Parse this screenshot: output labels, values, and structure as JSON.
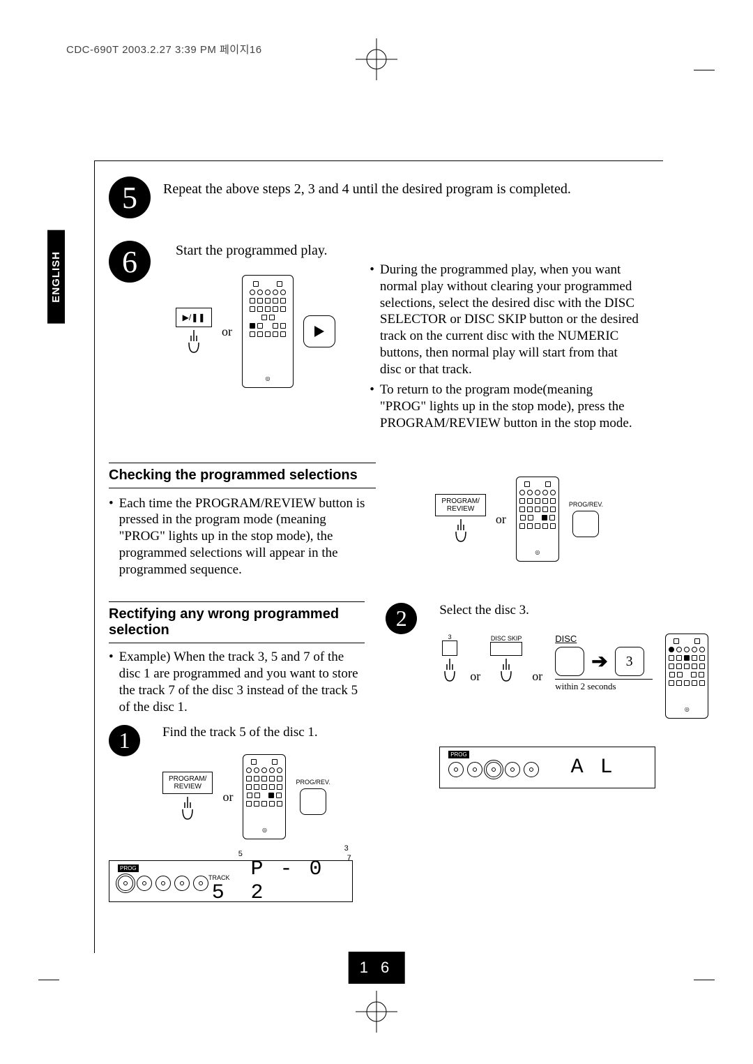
{
  "header": "CDC-690T  2003.2.27 3:39 PM  페이지16",
  "langTab": "ENGLISH",
  "pageNumber": "1 6",
  "step5": {
    "number": "5",
    "text": "Repeat the above steps 2, 3 and 4 until the desired program is completed."
  },
  "step6": {
    "number": "6",
    "text": "Start the programmed play.",
    "or": "or",
    "bullets": [
      "During the programmed play, when you want normal play without clearing your programmed selections, select the desired disc with the DISC SELECTOR or DISC SKIP button or the desired track on the current disc with the NUMERIC buttons, then normal play will start from that disc or that track.",
      "To return to the program mode(meaning \"PROG\" lights up in the stop mode), press the PROGRAM/REVIEW button in the stop mode."
    ],
    "playPauseLabel": "▶/❚❚"
  },
  "checking": {
    "heading": "Checking the programmed selections",
    "bullet": "Each time the PROGRAM/REVIEW button is pressed in the program mode (meaning \"PROG\" lights up in the stop mode), the programmed selections will appear in the programmed sequence.",
    "buttonLabel": "PROGRAM/\nREVIEW",
    "remoteBtnLabel": "PROG/REV.",
    "or": "or"
  },
  "rectifying": {
    "heading": "Rectifying any wrong programmed selection",
    "exampleLabel": "Example)",
    "exampleBody": "When the track 3, 5 and 7 of the disc 1 are programmed and you want to store the track 7 of the disc 3 instead of the track 5 of the disc 1.",
    "step1": {
      "num": "1",
      "text": "Find the track 5 of the disc 1.",
      "buttonLabel": "PROGRAM/\nREVIEW",
      "remoteBtnLabel": "PROG/REV.",
      "or": "or",
      "lcd": {
        "prog": "PROG",
        "trackLabel": "TRACK",
        "trackValue": "5",
        "super1": "5",
        "super2": "3",
        "super3": "7",
        "right": "P - 0 2"
      }
    },
    "step2": {
      "num": "2",
      "text": "Select the disc 3.",
      "or": "or",
      "numBtnLabel": "3",
      "numBtnTop": "3",
      "diskSkipLabel": "DISC SKIP",
      "discLabel": "DISC",
      "withinLabel": "within 2 seconds",
      "lcd": {
        "prog": "PROG",
        "right": "A L"
      }
    }
  }
}
